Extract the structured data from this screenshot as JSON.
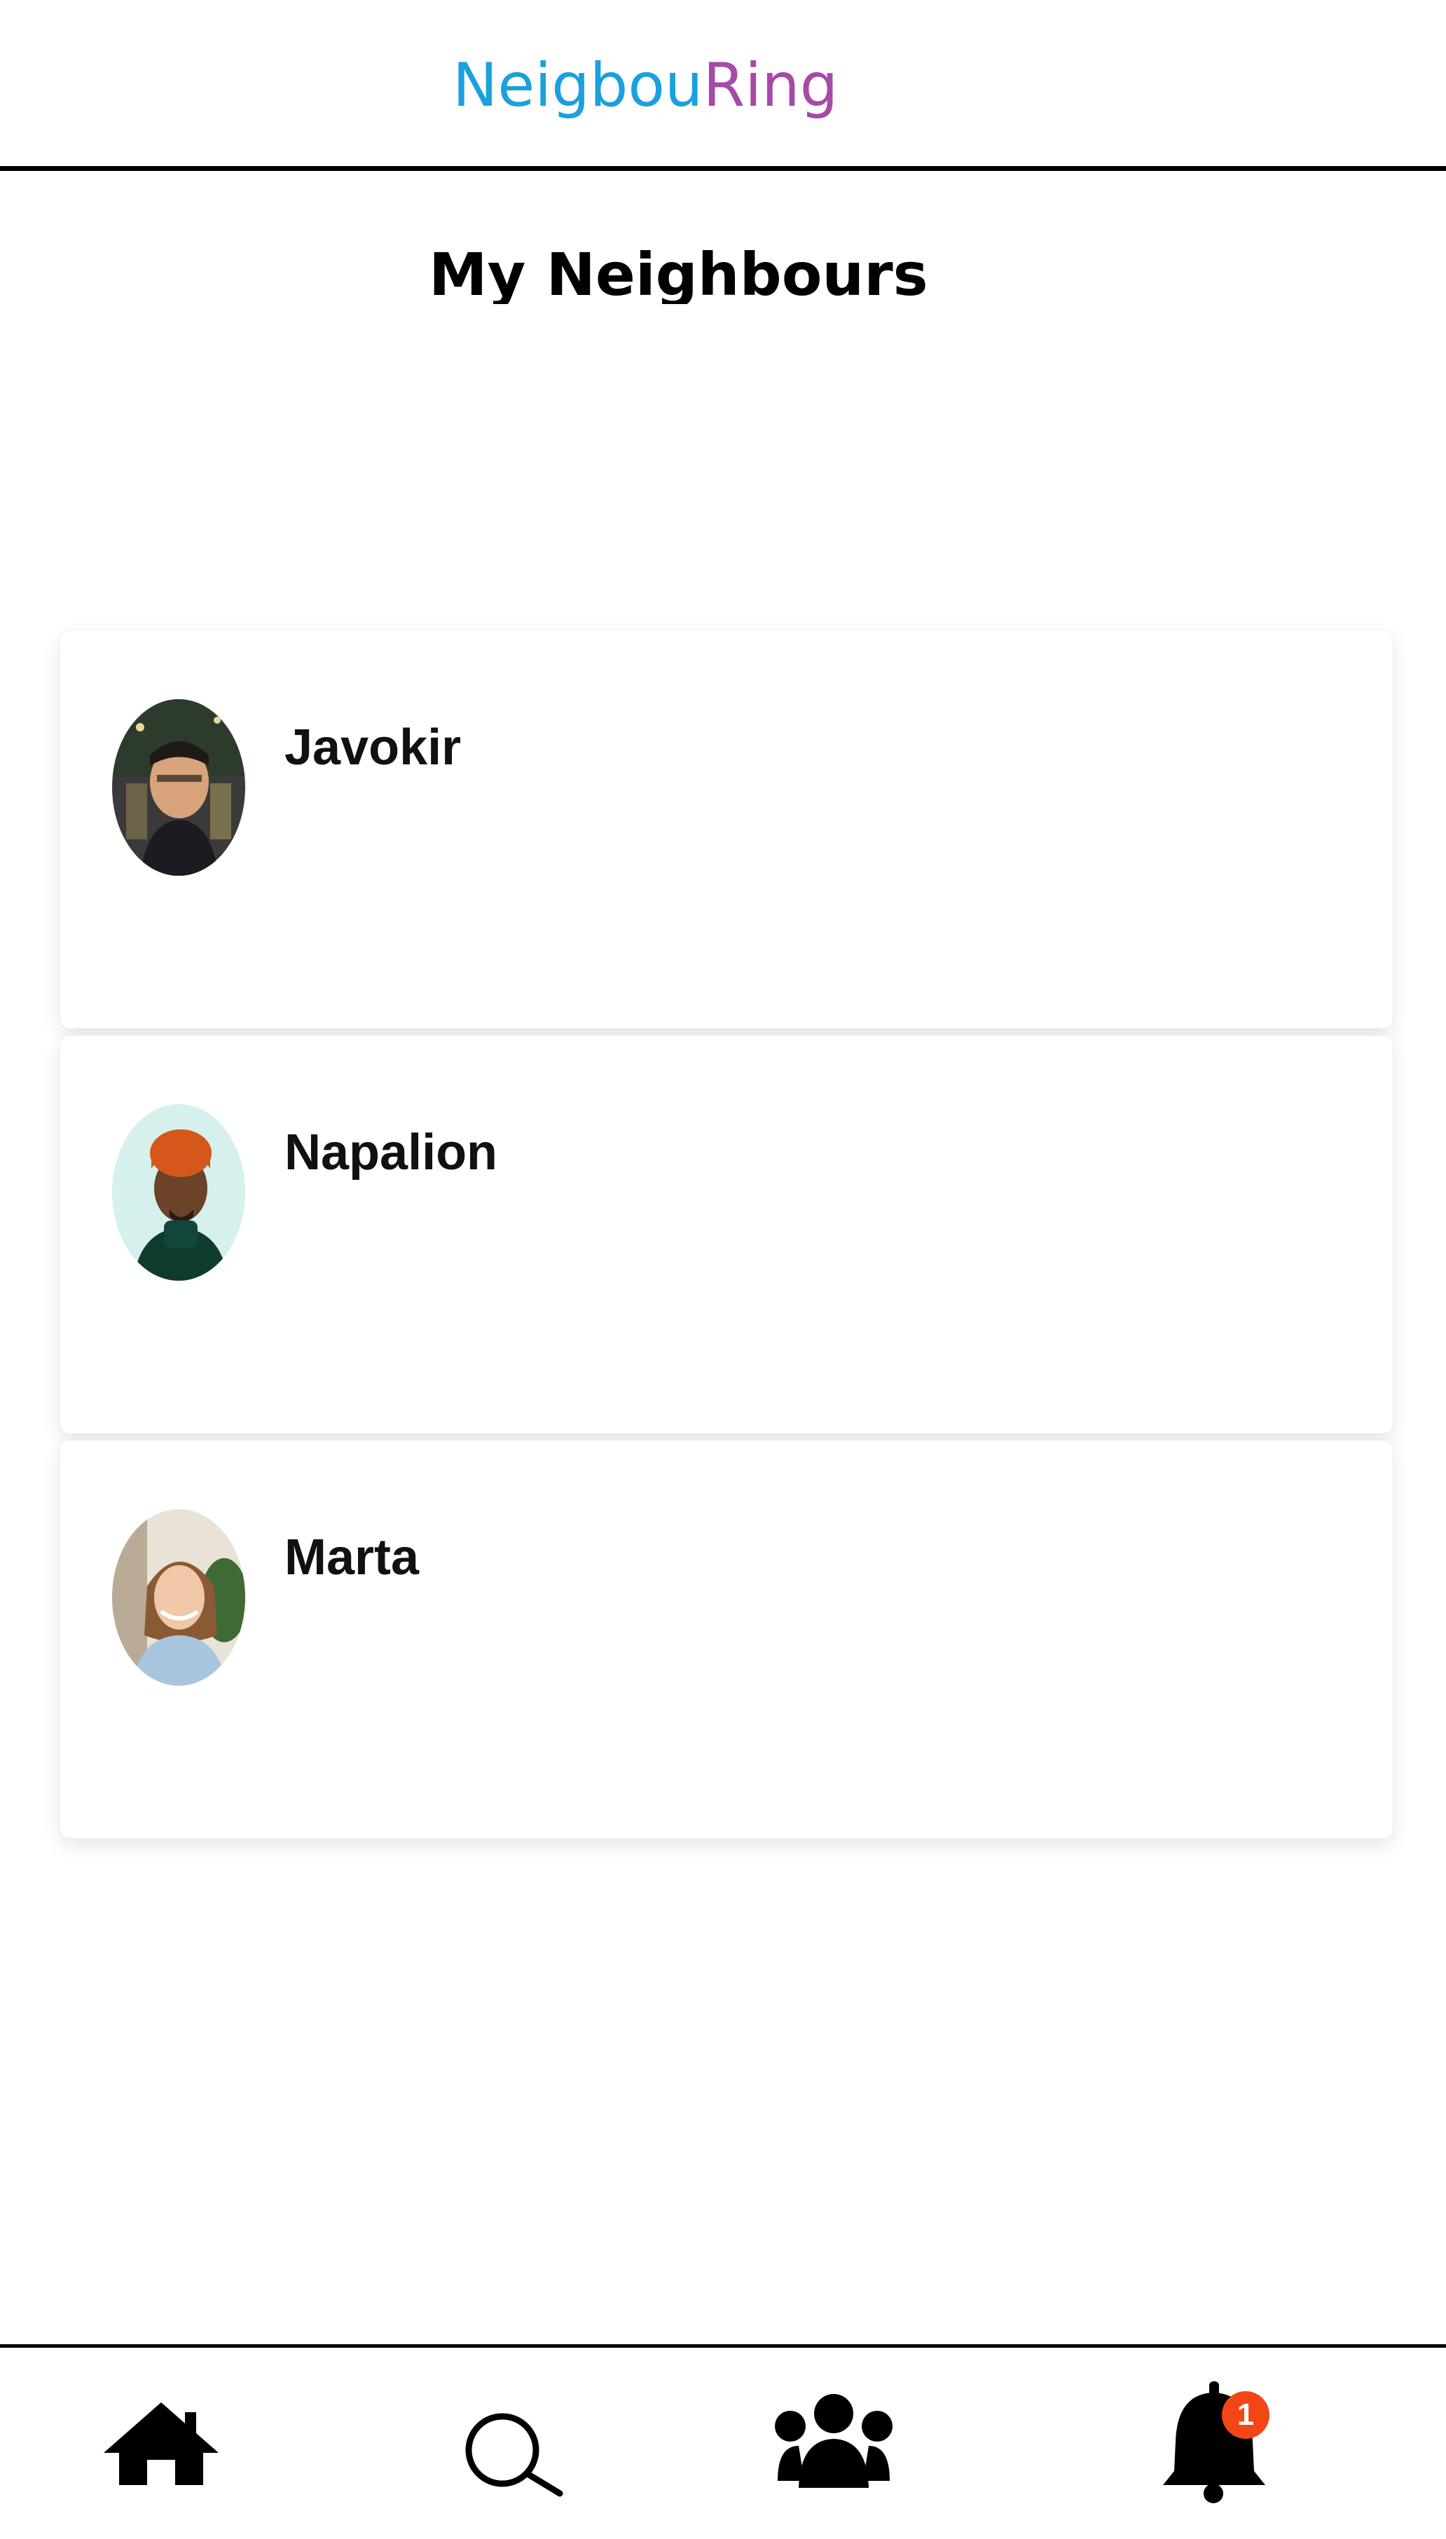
{
  "app": {
    "brand_part1": "Neigbou",
    "brand_part2": "Ring",
    "brand_colors": {
      "part1": "#1aa0dd",
      "part2": "#a54aa8"
    }
  },
  "page": {
    "title": "My Neighbours"
  },
  "neighbours": [
    {
      "name": "Javokir",
      "avatar": "avatar-photo-man-night"
    },
    {
      "name": "Napalion",
      "avatar": "avatar-photo-man-orange-beanie"
    },
    {
      "name": "Marta",
      "avatar": "avatar-photo-woman-smiling"
    }
  ],
  "bottom_nav": {
    "items": [
      {
        "id": "home",
        "icon": "home-icon"
      },
      {
        "id": "search",
        "icon": "search-icon"
      },
      {
        "id": "neighbours",
        "icon": "users-icon"
      },
      {
        "id": "notifications",
        "icon": "bell-icon",
        "badge": "1"
      }
    ],
    "badge_color": "#f24617"
  }
}
